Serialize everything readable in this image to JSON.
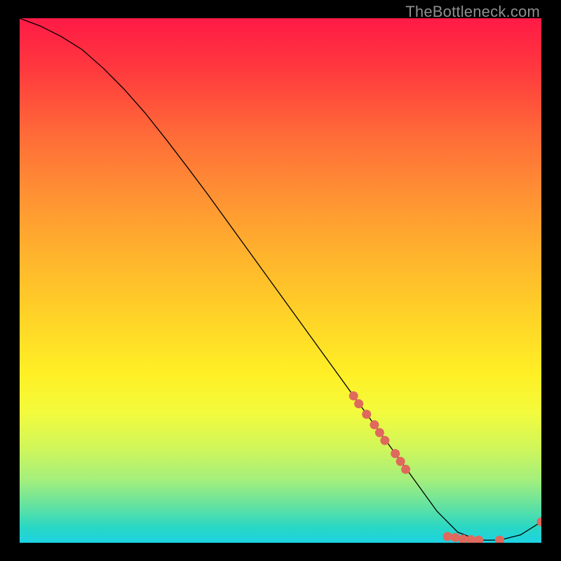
{
  "watermark": "TheBottleneck.com",
  "colors": {
    "marker": "#e0695d",
    "curve": "#000000"
  },
  "chart_data": {
    "type": "line",
    "title": "",
    "xlabel": "",
    "ylabel": "",
    "xlim": [
      0,
      100
    ],
    "ylim": [
      0,
      100
    ],
    "grid": false,
    "curve": {
      "x": [
        0,
        4,
        8,
        12,
        16,
        20,
        24,
        28,
        32,
        36,
        40,
        44,
        48,
        52,
        56,
        60,
        64,
        68,
        72,
        76,
        80,
        84,
        88,
        92,
        96,
        100
      ],
      "y": [
        100,
        98.5,
        96.5,
        94,
        90.5,
        86.5,
        82,
        77,
        71.8,
        66.5,
        61,
        55.5,
        50,
        44.5,
        39,
        33.5,
        28,
        22.5,
        17,
        11.5,
        6,
        2,
        0.5,
        0.5,
        1.5,
        4
      ]
    },
    "markers": [
      {
        "x": 64,
        "y": 28
      },
      {
        "x": 65,
        "y": 26.5
      },
      {
        "x": 66.5,
        "y": 24.5
      },
      {
        "x": 68,
        "y": 22.5
      },
      {
        "x": 69,
        "y": 21
      },
      {
        "x": 70,
        "y": 19.5
      },
      {
        "x": 72,
        "y": 17
      },
      {
        "x": 73,
        "y": 15.5
      },
      {
        "x": 74,
        "y": 14
      },
      {
        "x": 82,
        "y": 1.2
      },
      {
        "x": 83.5,
        "y": 1.0
      },
      {
        "x": 85,
        "y": 0.7
      },
      {
        "x": 86.5,
        "y": 0.6
      },
      {
        "x": 88,
        "y": 0.5
      },
      {
        "x": 92,
        "y": 0.5
      },
      {
        "x": 100,
        "y": 4.0
      }
    ]
  }
}
